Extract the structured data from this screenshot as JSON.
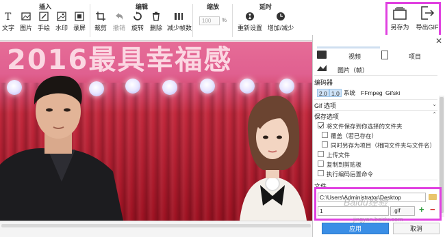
{
  "toolbar": {
    "groups": {
      "insert": {
        "title": "插入",
        "items": [
          "文字",
          "图片",
          "手绘",
          "水印",
          "录屏"
        ]
      },
      "edit": {
        "title": "编辑",
        "items": [
          "裁剪",
          "撤销",
          "旋转",
          "删除",
          "减少帧数"
        ]
      },
      "zoom": {
        "title": "缩放",
        "value": "100",
        "unit": "%"
      },
      "delay": {
        "title": "延时",
        "items": [
          "重新设置",
          "增加/减少"
        ]
      }
    },
    "save_as": "另存为",
    "export_gif": "导出GIF"
  },
  "canvas": {
    "banner_text": "2016最具幸福感"
  },
  "panel": {
    "tabs": {
      "video": "视频",
      "project": "项目",
      "image": "图片（帧）"
    },
    "encoder": {
      "label": "编码器",
      "options": [
        "2.0",
        "1.0",
        "系统",
        "FFmpeg",
        "Gifski"
      ],
      "selected": [
        "2.0",
        "1.0"
      ]
    },
    "gif_options": "Gif 选项",
    "save_options": {
      "label": "保存选项",
      "save_to_folder": "将文件保存到你选择的文件夹",
      "overwrite": "覆盖（若已存在）",
      "save_as_project": "同时另存为项目（相同文件夹与文件名）",
      "upload": "上传文件",
      "copy_clipboard": "复制到剪贴板",
      "post_encode": "执行编码后置命令"
    },
    "file": {
      "label": "文件",
      "path": "C:\\Users\\Administrator\\Desktop",
      "name": "1",
      "ext": ".gif"
    },
    "apply": "应用",
    "cancel": "取消"
  },
  "watermark": {
    "main": "Baidu经验",
    "sub": "jingyan.baidu.com"
  },
  "colors": {
    "highlight": "#e040e0",
    "primary": "#3a8ee6"
  }
}
